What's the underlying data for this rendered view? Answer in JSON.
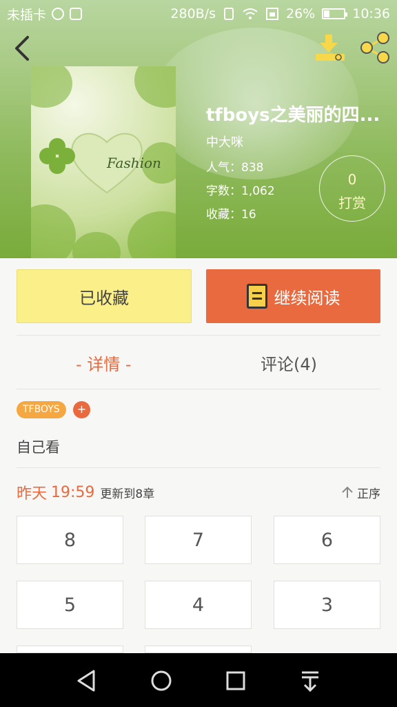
{
  "status_bar": {
    "carrier": "未插卡",
    "speed": "280B/s",
    "battery": "26%",
    "battery_level": 0.26,
    "time": "10:36"
  },
  "header": {
    "cover_text": "Fashion",
    "book_title": "tfboys之美丽的四...",
    "author": "中大咪",
    "popularity_label": "人气：",
    "popularity": "838",
    "word_count_label": "字数：",
    "word_count": "1,062",
    "favorites_label": "收藏：",
    "favorites": "16",
    "tip_count": "0",
    "tip_label": "打赏"
  },
  "actions": {
    "favorited_label": "已收藏",
    "continue_label": "继续阅读"
  },
  "tabs": {
    "detail": "- 详情 -",
    "comments": "评论(4)"
  },
  "tags": [
    "TFBOYS"
  ],
  "tag_add": "+",
  "description": "自己看",
  "update": {
    "day": "昨天",
    "time": "19:59",
    "text": "更新到8章",
    "sort_label": "正序"
  },
  "chapters": [
    "8",
    "7",
    "6",
    "5",
    "4",
    "3"
  ],
  "colors": {
    "accent": "#e96a3e",
    "favorite_button": "#fbef8a",
    "tag": "#f5a842"
  }
}
